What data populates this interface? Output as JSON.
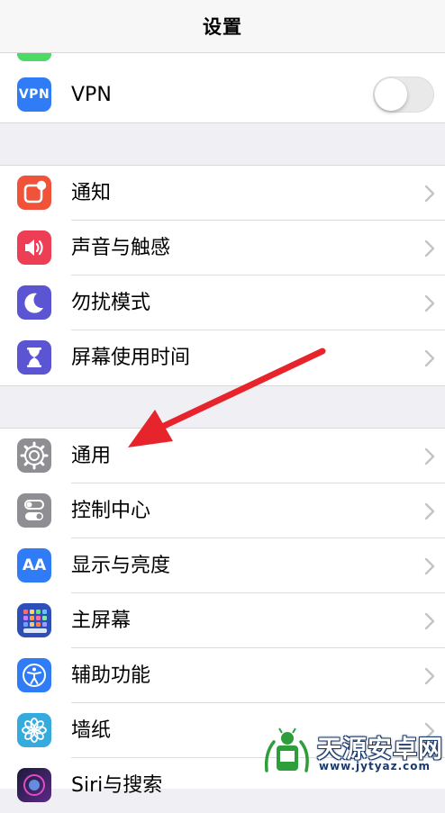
{
  "nav": {
    "title": "设置"
  },
  "colors": {
    "accent_red_arrow": "#E7242C",
    "vpn": "#2F7CF6",
    "notifications": "#F0533A",
    "sounds": "#EE3E55",
    "dnd": "#5B55D4",
    "screen_time": "#5B55D4",
    "general": "#8E8E93",
    "control_center": "#8E8E93",
    "display": "#2F7CF6",
    "home_screen": "#2F6BE8",
    "accessibility": "#2F7CF6",
    "wallpaper": "#35AADC"
  },
  "vpn": {
    "label": "VPN",
    "icon_text": "VPN",
    "toggle_on": false
  },
  "group1": [
    {
      "label": "通知",
      "icon": "notification-icon"
    },
    {
      "label": "声音与触感",
      "icon": "speaker-icon"
    },
    {
      "label": "勿扰模式",
      "icon": "moon-icon"
    },
    {
      "label": "屏幕使用时间",
      "icon": "hourglass-icon"
    }
  ],
  "group2": [
    {
      "label": "通用",
      "icon": "gear-icon"
    },
    {
      "label": "控制中心",
      "icon": "toggles-icon"
    },
    {
      "label": "显示与亮度",
      "icon": "aa-icon",
      "icon_text": "AA"
    },
    {
      "label": "主屏幕",
      "icon": "home-grid-icon"
    },
    {
      "label": "辅助功能",
      "icon": "accessibility-icon"
    },
    {
      "label": "墙纸",
      "icon": "flower-icon"
    },
    {
      "label": "Siri与搜索",
      "icon": "siri-icon"
    }
  ],
  "watermark": {
    "title": "天源安卓网",
    "url": "www.jytyaz.com"
  }
}
